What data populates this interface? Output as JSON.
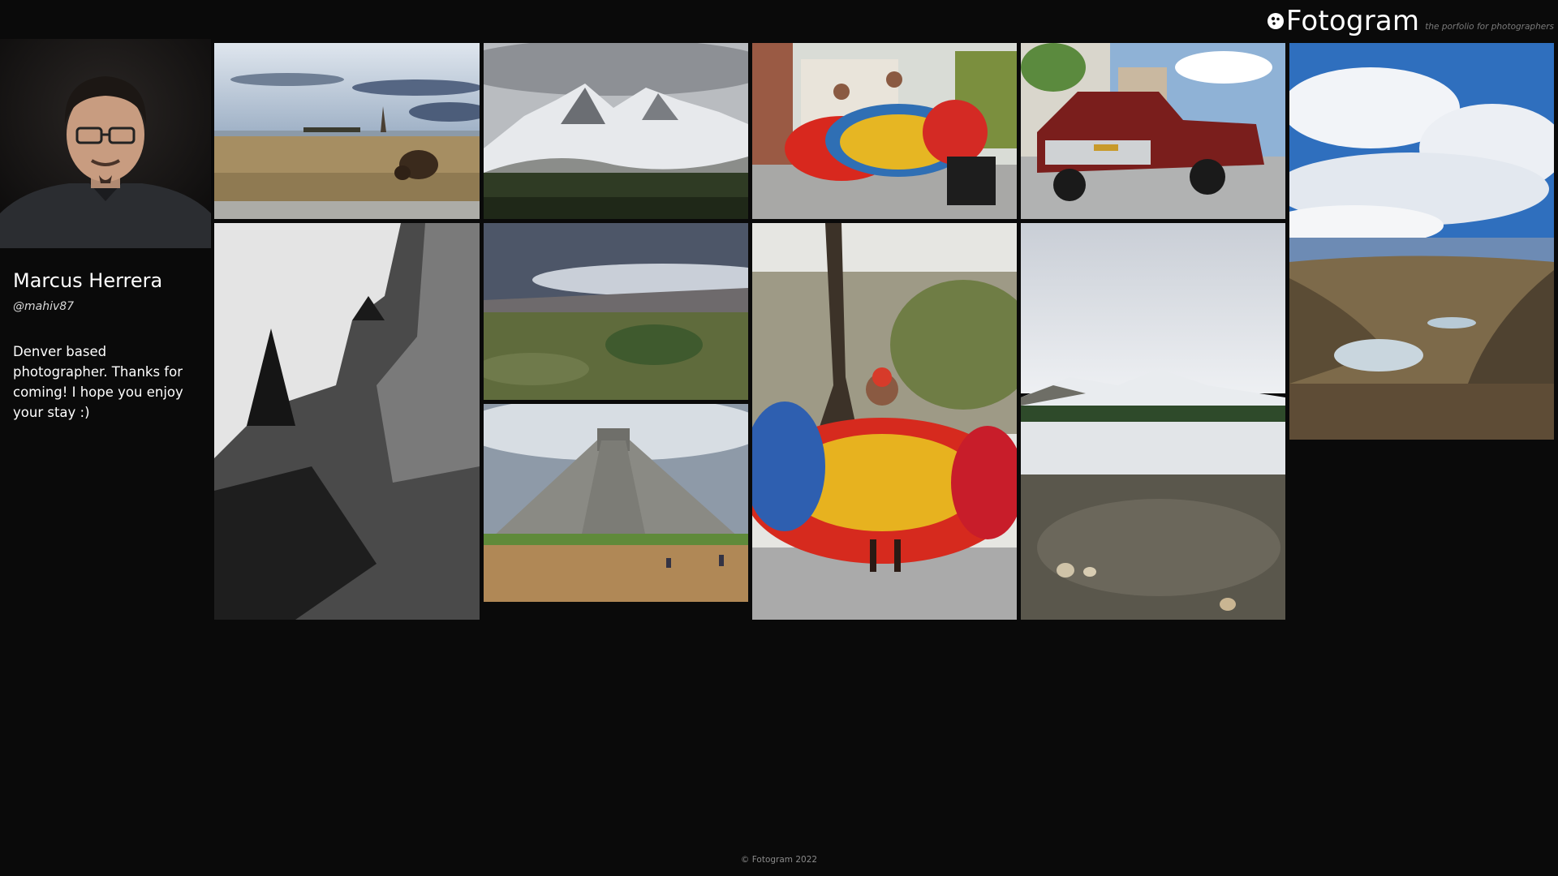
{
  "brand": {
    "name": "Fotogram",
    "tagline": "the porfolio for photographers",
    "logo_icon": "camera-aperture-icon"
  },
  "profile": {
    "name": "Marcus Herrera",
    "handle": "@mahiv87",
    "bio": "Denver based photographer. Thanks for coming! I hope you enjoy your stay :)"
  },
  "gallery": {
    "photos": [
      {
        "subject": "bison-on-prairie"
      },
      {
        "subject": "snowy-mountain-peaks"
      },
      {
        "subject": "folk-dancers-street"
      },
      {
        "subject": "red-lowrider-truck"
      },
      {
        "subject": "cloudy-alpine-valley"
      },
      {
        "subject": "black-and-white-cliff"
      },
      {
        "subject": "sand-dunes-grassland"
      },
      {
        "subject": "folk-dancers-closeup"
      },
      {
        "subject": "frozen-mountain-lake"
      },
      {
        "subject": "step-pyramid-ruins"
      }
    ]
  },
  "footer": {
    "copyright": "© Fotogram 2022"
  }
}
